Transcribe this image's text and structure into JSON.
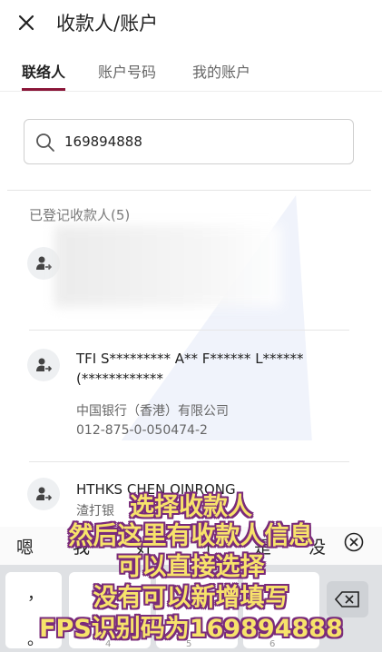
{
  "header": {
    "title": "收款人/账户"
  },
  "tabs": [
    {
      "label": "联络人",
      "active": true
    },
    {
      "label": "账户号码",
      "active": false
    },
    {
      "label": "我的账户",
      "active": false
    }
  ],
  "search": {
    "value": "169894888"
  },
  "section": {
    "title": "已登记收款人(5)"
  },
  "payees": [
    {
      "name": "",
      "blurred": true
    },
    {
      "name": "TFI S********* A** F****** L****** (************",
      "bank": "中国银行（香港）有限公司",
      "account": "012-875-0-050474-2"
    },
    {
      "name": "HTHKS CHEN QINRONG",
      "bank": "渣打银"
    }
  ],
  "ime": {
    "candidates": [
      "嗯",
      "我",
      "好",
      "了",
      "是",
      "没"
    ]
  },
  "keyboard": {
    "punct": "，",
    "punct2": "。",
    "numbers": [
      "4",
      "5",
      "6"
    ]
  },
  "overlay": {
    "lines": [
      "选择收款人",
      "然后这里有收款人信息",
      "可以直接选择",
      "没有可以新增填写",
      "FPS识别码为169894888"
    ]
  },
  "colors": {
    "accent": "#8a1538",
    "overlay_text": "#f7e36b",
    "overlay_outline": "#7a2b7a"
  }
}
